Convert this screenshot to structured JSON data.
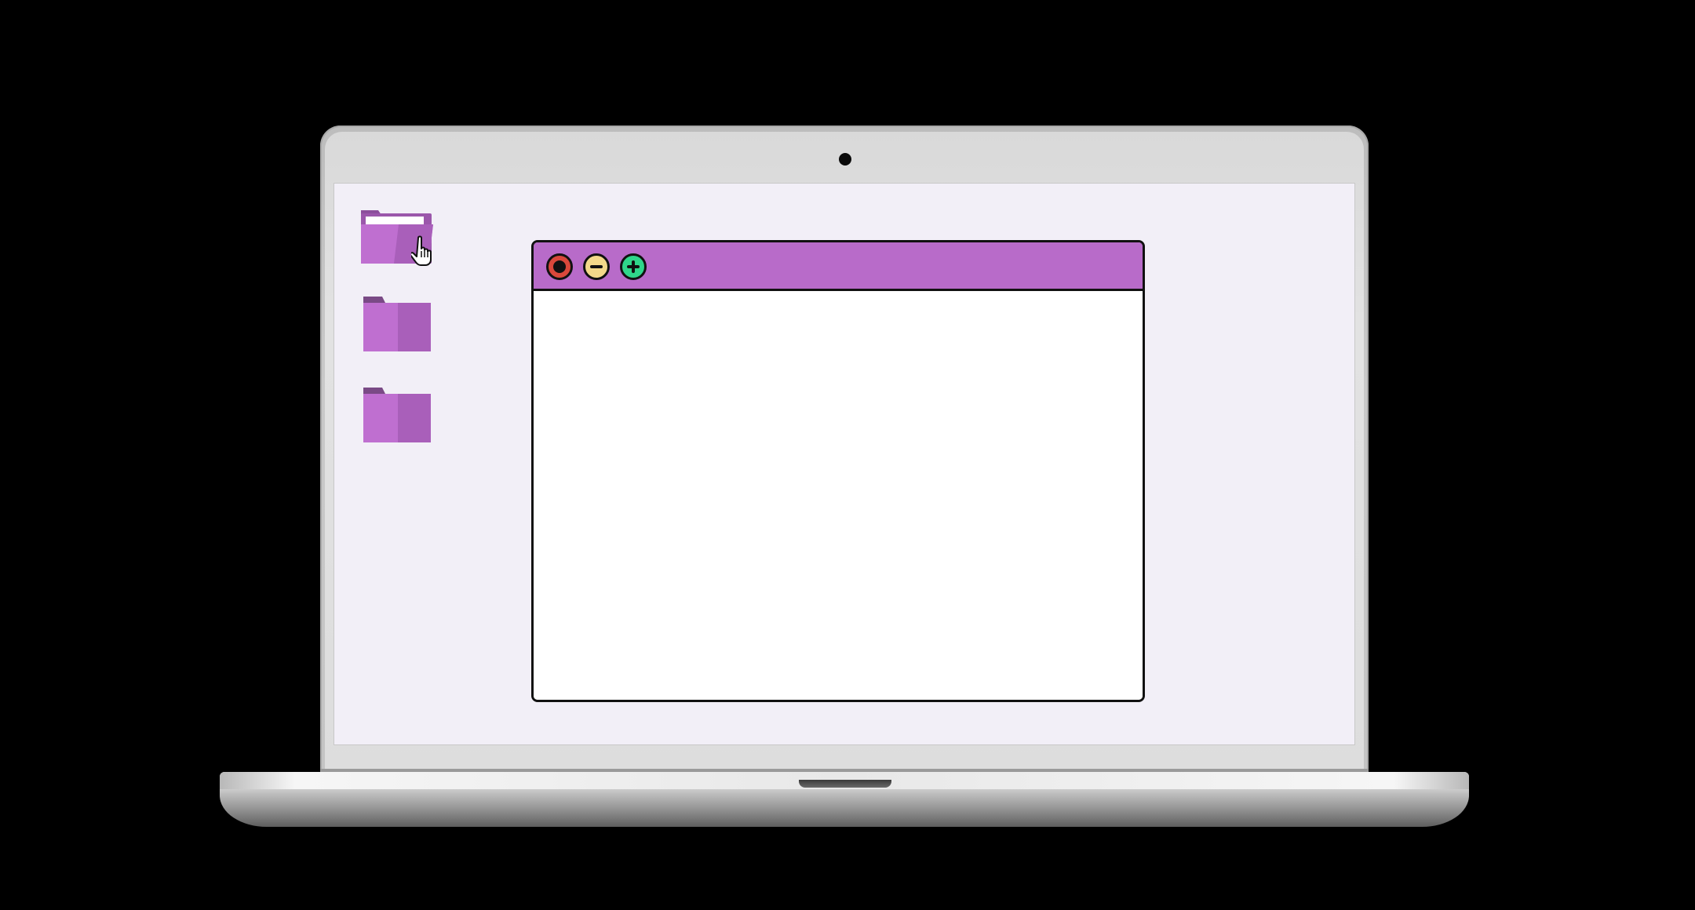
{
  "device": {
    "type": "laptop",
    "camera": "webcam-dot"
  },
  "desktop": {
    "background_color": "#f2eff7",
    "folders": [
      {
        "icon": "folder-open-icon",
        "state": "hovered",
        "color": "#b86bc9"
      },
      {
        "icon": "folder-icon",
        "state": "closed",
        "color": "#b86bc9"
      },
      {
        "icon": "folder-icon",
        "state": "closed",
        "color": "#b86bc9"
      }
    ],
    "cursor": "hand-pointer-icon"
  },
  "window": {
    "titlebar_color": "#b86bc9",
    "controls": [
      {
        "icon": "close-icon",
        "color": "#d9483b"
      },
      {
        "icon": "minimize-icon",
        "color": "#f3d98a"
      },
      {
        "icon": "maximize-icon",
        "color": "#2fd68a"
      }
    ],
    "body_color": "#ffffff"
  }
}
